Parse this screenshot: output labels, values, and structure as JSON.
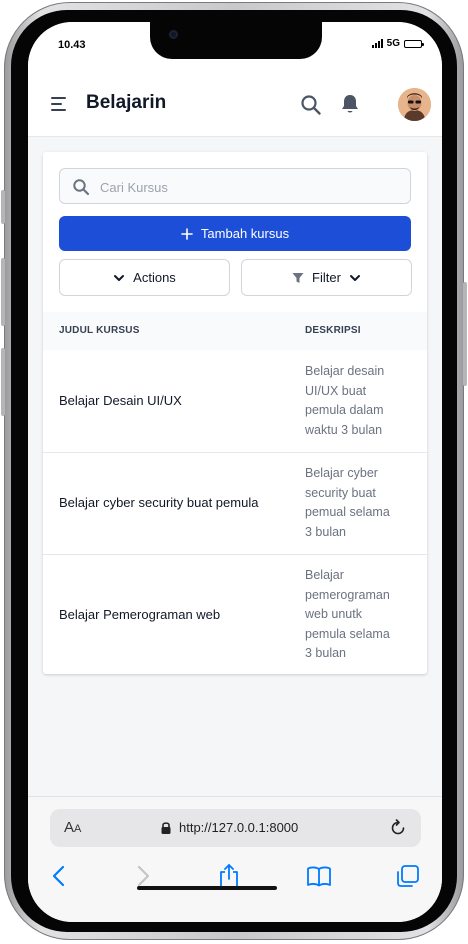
{
  "status": {
    "time": "10.43",
    "network": "5G"
  },
  "header": {
    "title": "Belajarin"
  },
  "search": {
    "placeholder": "Cari Kursus"
  },
  "buttons": {
    "add_course": "Tambah kursus",
    "actions": "Actions",
    "filter": "Filter"
  },
  "table": {
    "headers": [
      "JUDUL KURSUS",
      "DESKRIPSI"
    ],
    "rows": [
      {
        "title": "Belajar Desain UI/UX",
        "desc": [
          "Belajar desain",
          "UI/UX buat",
          "pemula dalam",
          "waktu 3 bulan"
        ]
      },
      {
        "title": "Belajar cyber security buat pemula",
        "desc": [
          "Belajar cyber",
          "security buat",
          "pemual selama",
          "3 bulan"
        ]
      },
      {
        "title": "Belajar Pemerograman web",
        "desc": [
          "Belajar",
          "pemerograman",
          "web unutk",
          "pemula selama",
          "3 bulan"
        ]
      }
    ]
  },
  "browser": {
    "aa_large": "A",
    "aa_small": "A",
    "url": "http://127.0.0.1:8000"
  },
  "colors": {
    "primary": "#1d4ed8",
    "header_text": "#111827",
    "muted": "#6b7280",
    "ios_blue": "#007aff"
  },
  "icons": [
    "menu-icon",
    "search-icon",
    "bell-icon",
    "avatar",
    "plus-icon",
    "chevron-down-icon",
    "filter-icon",
    "lock-icon",
    "reload-icon",
    "back-icon",
    "forward-icon",
    "share-icon",
    "bookmarks-icon",
    "tabs-icon"
  ]
}
